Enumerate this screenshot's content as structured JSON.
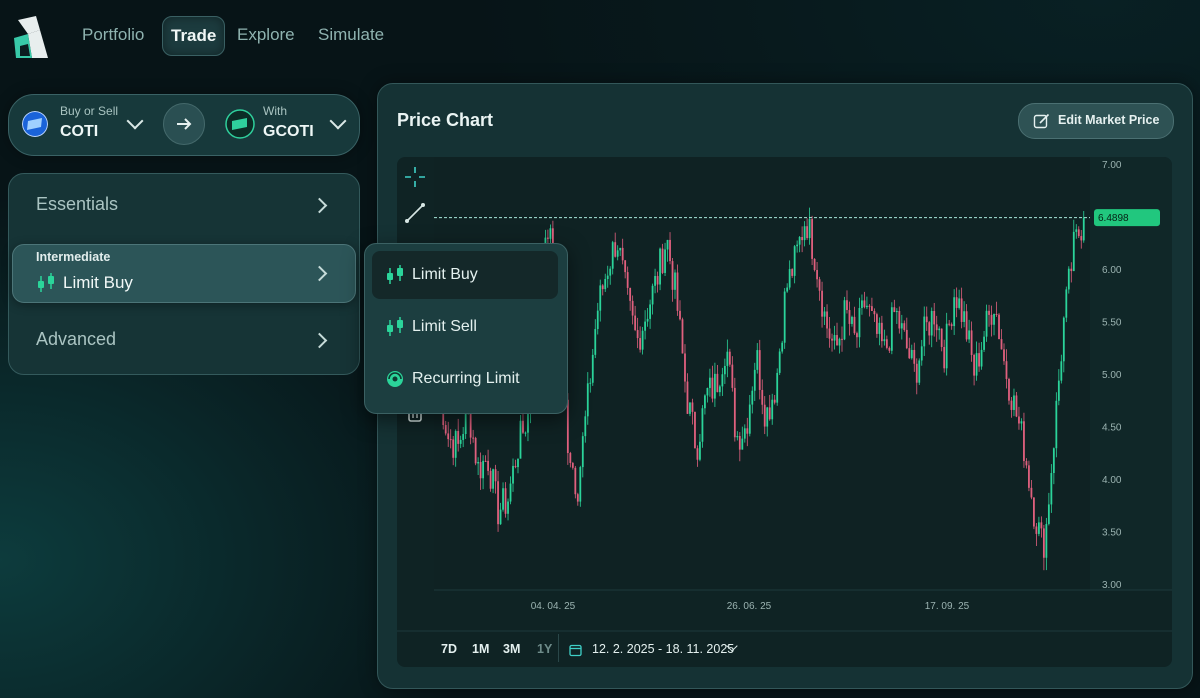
{
  "nav": {
    "tabs": [
      {
        "label": "Portfolio",
        "active": false
      },
      {
        "label": "Trade",
        "active": true
      },
      {
        "label": "Explore",
        "active": false
      },
      {
        "label": "Simulate",
        "active": false
      }
    ]
  },
  "pair": {
    "from_caption": "Buy or Sell",
    "from_coin": "COTI",
    "to_caption": "With",
    "to_coin": "GCOTI"
  },
  "strategy": {
    "essentials_label": "Essentials",
    "intermediate_caption": "Intermediate",
    "intermediate_value": "Limit Buy",
    "advanced_label": "Advanced"
  },
  "dropdown": {
    "items": [
      "Limit Buy",
      "Limit Sell",
      "Recurring Limit"
    ],
    "selected": "Limit Buy"
  },
  "chart_header": {
    "title": "Price Chart",
    "edit_button": "Edit Market Price"
  },
  "range_buttons": [
    "7D",
    "1M",
    "3M",
    "1Y"
  ],
  "date_range": "12. 2. 2025 - 18. 11. 2025",
  "chart_data": {
    "type": "candlestick",
    "title": "",
    "y_ticks": [
      "7.00",
      "6.00",
      "5.50",
      "5.00",
      "4.50",
      "4.00",
      "3.50",
      "3.00"
    ],
    "y_range": [
      3.0,
      7.0
    ],
    "x_ticks": [
      "04. 04. 25",
      "26. 06. 25",
      "17. 09. 25"
    ],
    "market_price": "6.4898",
    "up_color": "#2bd49a",
    "down_color": "#e0607e",
    "close_series": [
      4.9,
      4.4,
      4.3,
      4.7,
      4.1,
      4.2,
      3.7,
      3.8,
      4.3,
      4.6,
      5.2,
      6.4,
      5.9,
      4.4,
      3.9,
      4.7,
      5.6,
      6.0,
      6.3,
      5.7,
      5.3,
      5.6,
      5.9,
      6.3,
      5.7,
      4.8,
      4.3,
      4.8,
      4.9,
      5.3,
      4.4,
      4.5,
      5.2,
      4.6,
      4.9,
      5.8,
      6.1,
      6.5,
      6.1,
      5.5,
      5.2,
      5.6,
      5.3,
      5.7,
      5.4,
      5.2,
      5.6,
      5.3,
      5.0,
      5.4,
      5.6,
      5.2,
      5.8,
      5.5,
      5.0,
      5.4,
      5.7,
      5.1,
      4.7,
      4.3,
      3.7,
      3.3,
      4.4,
      5.5,
      6.2,
      6.49
    ]
  }
}
